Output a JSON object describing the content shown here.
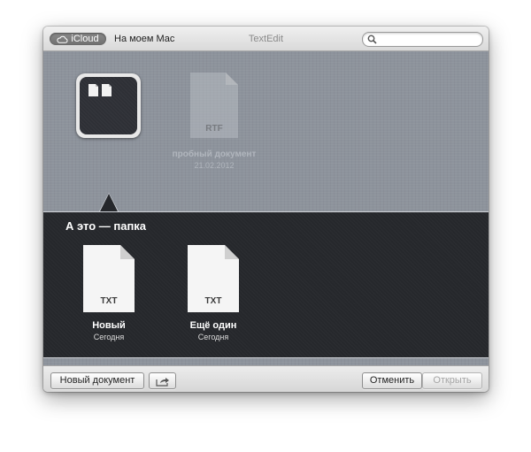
{
  "titlebar": {
    "icloud_label": "iCloud",
    "on_mac_label": "На моем Mac",
    "app_title": "TextEdit",
    "search_placeholder": ""
  },
  "browser": {
    "ghost_document": {
      "type": "RTF",
      "name": "пробный документ",
      "date": "21.02.2012"
    }
  },
  "folder": {
    "title": "А это — папка",
    "documents": [
      {
        "type": "TXT",
        "name": "Новый",
        "date": "Сегодня"
      },
      {
        "type": "TXT",
        "name": "Ещё один",
        "date": "Сегодня"
      }
    ]
  },
  "bottombar": {
    "new_document_label": "Новый документ",
    "share_icon": "share-arrow-icon",
    "cancel_label": "Отменить",
    "open_label": "Открыть"
  },
  "colors": {
    "browser_bg": "#8d939c",
    "folder_bg": "#26282c",
    "icloud_segment": "#777777"
  }
}
